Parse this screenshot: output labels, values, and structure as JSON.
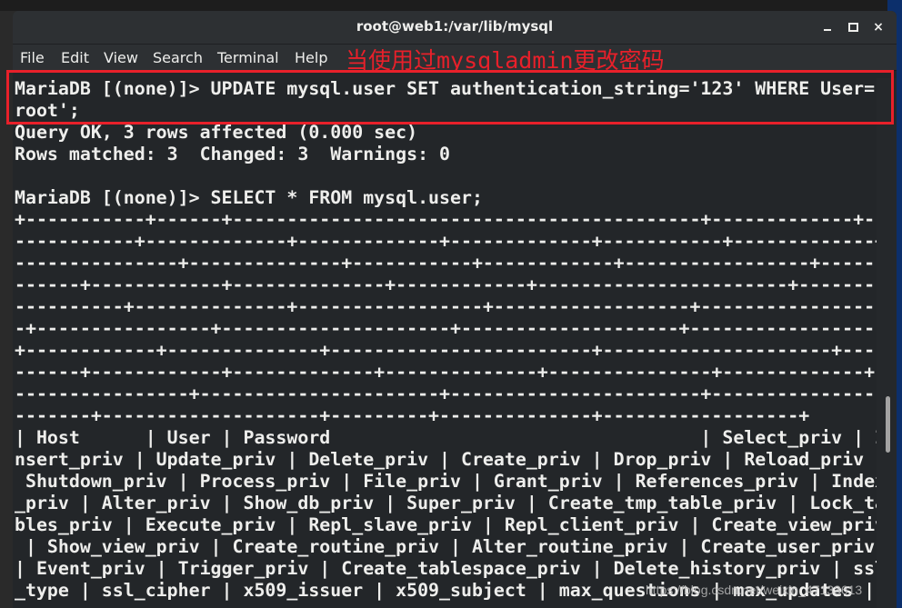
{
  "window": {
    "title": "root@web1:/var/lib/mysql",
    "minimize_label": "_",
    "maximize_label": "",
    "close_label": "×"
  },
  "menu": {
    "items": [
      "File",
      "Edit",
      "View",
      "Search",
      "Terminal",
      "Help"
    ]
  },
  "annotation": {
    "text": "当使用过mysqladmin更改密码",
    "color": "#e8202a"
  },
  "terminal": {
    "lines": [
      "MariaDB [(none)]> UPDATE mysql.user SET authentication_string='123' WHERE User='",
      "root';",
      "Query OK, 3 rows affected (0.000 sec)",
      "Rows matched: 3  Changed: 3  Warnings: 0",
      "",
      "MariaDB [(none)]> SELECT * FROM mysql.user;",
      "+-----------+------+-------------------------------------------+-------------+--",
      "-----------+-------------+-------------+-------------+-----------+-------------+",
      "---------------+--------------+-----------+------------+-----------------+------",
      "------+------------+--------------+------------+-----------------------+--------",
      "----------+--------------+-----------------+------------------+-----------------",
      "-+----------------+---------------------+--------------------+------------------",
      "+------------+--------------+------------------------+---------------------+----",
      "------+------------+-------------+--------------+---------------+-------------+-",
      "----------------+----------------------+-----------------------+----------------",
      "-------+--------------------+---------+--------------+------------------+",
      "| Host      | User | Password                                  | Select_priv | I",
      "nsert_priv | Update_priv | Delete_priv | Create_priv | Drop_priv | Reload_priv |",
      " Shutdown_priv | Process_priv | File_priv | Grant_priv | References_priv | Index",
      "_priv | Alter_priv | Show_db_priv | Super_priv | Create_tmp_table_priv | Lock_ta",
      "bles_priv | Execute_priv | Repl_slave_priv | Repl_client_priv | Create_view_priv",
      " | Show_view_priv | Create_routine_priv | Alter_routine_priv | Create_user_priv ",
      "| Event_priv | Trigger_priv | Create_tablespace_priv | Delete_history_priv | ssl",
      "_type | ssl_cipher | x509_issuer | x509_subject | max_questions | max_updates | "
    ]
  },
  "watermark": "https://blog.csdn.net/weixin_47133613"
}
